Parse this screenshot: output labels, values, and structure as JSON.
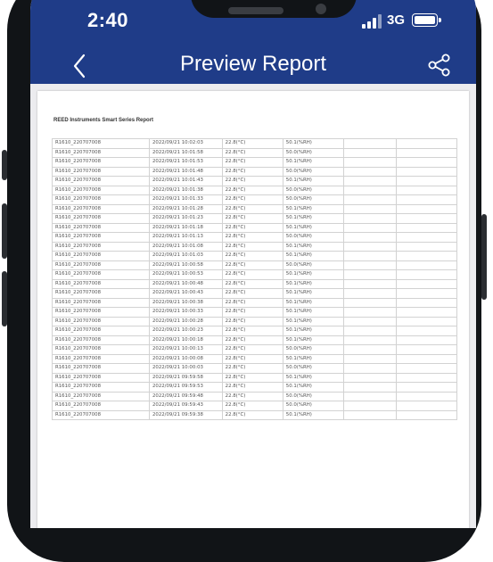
{
  "status_bar": {
    "time": "2:40",
    "network": "3G"
  },
  "header": {
    "title": "Preview Report"
  },
  "report": {
    "title": "REED Instruments Smart Series Report",
    "rows": [
      [
        "R1610_220707008",
        "2022/09/21 10:02:03",
        "22.8(°C)",
        "50.1(%RH)"
      ],
      [
        "R1610_220707008",
        "2022/09/21 10:01:58",
        "22.8(°C)",
        "50.0(%RH)"
      ],
      [
        "R1610_220707008",
        "2022/09/21 10:01:53",
        "22.8(°C)",
        "50.1(%RH)"
      ],
      [
        "R1610_220707008",
        "2022/09/21 10:01:48",
        "22.8(°C)",
        "50.0(%RH)"
      ],
      [
        "R1610_220707008",
        "2022/09/21 10:01:43",
        "22.8(°C)",
        "50.1(%RH)"
      ],
      [
        "R1610_220707008",
        "2022/09/21 10:01:38",
        "22.8(°C)",
        "50.0(%RH)"
      ],
      [
        "R1610_220707008",
        "2022/09/21 10:01:33",
        "22.8(°C)",
        "50.0(%RH)"
      ],
      [
        "R1610_220707008",
        "2022/09/21 10:01:28",
        "22.8(°C)",
        "50.1(%RH)"
      ],
      [
        "R1610_220707008",
        "2022/09/21 10:01:23",
        "22.8(°C)",
        "50.1(%RH)"
      ],
      [
        "R1610_220707008",
        "2022/09/21 10:01:18",
        "22.8(°C)",
        "50.1(%RH)"
      ],
      [
        "R1610_220707008",
        "2022/09/21 10:01:13",
        "22.8(°C)",
        "50.0(%RH)"
      ],
      [
        "R1610_220707008",
        "2022/09/21 10:01:08",
        "22.8(°C)",
        "50.1(%RH)"
      ],
      [
        "R1610_220707008",
        "2022/09/21 10:01:03",
        "22.8(°C)",
        "50.1(%RH)"
      ],
      [
        "R1610_220707008",
        "2022/09/21 10:00:58",
        "22.8(°C)",
        "50.0(%RH)"
      ],
      [
        "R1610_220707008",
        "2022/09/21 10:00:53",
        "22.8(°C)",
        "50.1(%RH)"
      ],
      [
        "R1610_220707008",
        "2022/09/21 10:00:48",
        "22.8(°C)",
        "50.1(%RH)"
      ],
      [
        "R1610_220707008",
        "2022/09/21 10:00:43",
        "22.8(°C)",
        "50.1(%RH)"
      ],
      [
        "R1610_220707008",
        "2022/09/21 10:00:38",
        "22.8(°C)",
        "50.1(%RH)"
      ],
      [
        "R1610_220707008",
        "2022/09/21 10:00:33",
        "22.8(°C)",
        "50.1(%RH)"
      ],
      [
        "R1610_220707008",
        "2022/09/21 10:00:28",
        "22.8(°C)",
        "50.1(%RH)"
      ],
      [
        "R1610_220707008",
        "2022/09/21 10:00:23",
        "22.8(°C)",
        "50.1(%RH)"
      ],
      [
        "R1610_220707008",
        "2022/09/21 10:00:18",
        "22.8(°C)",
        "50.1(%RH)"
      ],
      [
        "R1610_220707008",
        "2022/09/21 10:00:13",
        "22.8(°C)",
        "50.0(%RH)"
      ],
      [
        "R1610_220707008",
        "2022/09/21 10:00:08",
        "22.8(°C)",
        "50.1(%RH)"
      ],
      [
        "R1610_220707008",
        "2022/09/21 10:00:03",
        "22.8(°C)",
        "50.0(%RH)"
      ],
      [
        "R1610_220707008",
        "2022/09/21 09:59:58",
        "22.8(°C)",
        "50.1(%RH)"
      ],
      [
        "R1610_220707008",
        "2022/09/21 09:59:53",
        "22.8(°C)",
        "50.1(%RH)"
      ],
      [
        "R1610_220707008",
        "2022/09/21 09:59:48",
        "22.8(°C)",
        "50.0(%RH)"
      ],
      [
        "R1610_220707008",
        "2022/09/21 09:59:43",
        "22.8(°C)",
        "50.0(%RH)"
      ],
      [
        "R1610_220707008",
        "2022/09/21 09:59:38",
        "22.8(°C)",
        "50.1(%RH)"
      ]
    ]
  },
  "colors": {
    "header_blue": "#1f3c88",
    "phone_frame": "#111417",
    "content_bg": "#ececef"
  },
  "icons": {
    "back": "chevron-left-icon",
    "share": "share-icon",
    "signal": "cellular-signal-icon",
    "battery": "battery-icon"
  }
}
